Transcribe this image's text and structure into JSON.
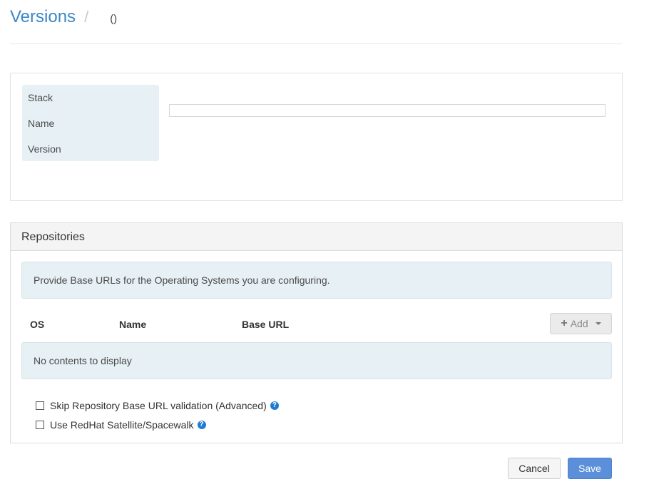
{
  "breadcrumb": {
    "root": "Versions",
    "separator": "/",
    "current": "()"
  },
  "details": {
    "labels": [
      "Stack",
      "Name",
      "Version"
    ],
    "name_value": ""
  },
  "repositories": {
    "title": "Repositories",
    "info_text": "Provide Base URLs for the Operating Systems you are configuring.",
    "columns": {
      "os": "OS",
      "name": "Name",
      "base_url": "Base URL"
    },
    "add_label": "Add",
    "empty_text": "No contents to display",
    "options": [
      {
        "label": "Skip Repository Base URL validation (Advanced)",
        "checked": false
      },
      {
        "label": "Use RedHat Satellite/Spacewalk",
        "checked": false
      }
    ],
    "help_glyph": "?"
  },
  "footer": {
    "cancel_label": "Cancel",
    "save_label": "Save"
  },
  "colors": {
    "link": "#3a87c8",
    "info_bg": "#e7f0f4",
    "primary": "#5b8fd9",
    "help_icon": "#1f7bd1"
  }
}
